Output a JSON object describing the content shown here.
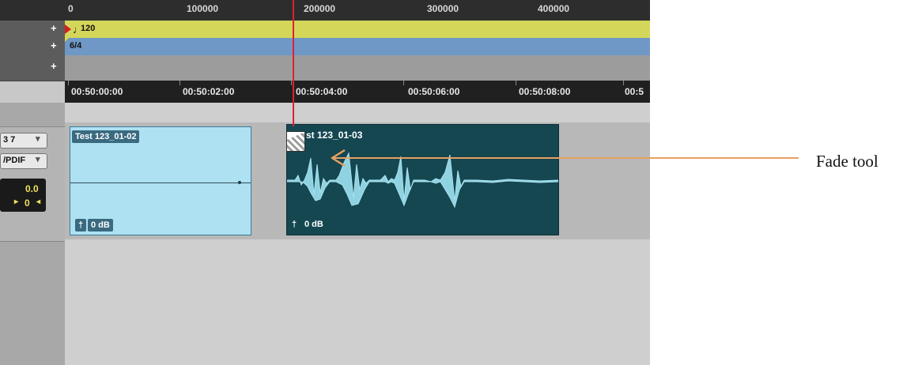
{
  "sample_ruler": {
    "ticks": [
      "0",
      "100000",
      "200000",
      "300000",
      "400000"
    ]
  },
  "tempo_lane": {
    "value": "120"
  },
  "meter_lane": {
    "value": "6/4"
  },
  "timecode_ruler": {
    "ticks": [
      "00:50:00:00",
      "00:50:02:00",
      "00:50:04:00",
      "00:50:06:00",
      "00:50:08:00",
      "00:5"
    ]
  },
  "track_header": {
    "output_label": "3 7",
    "input_label": "/PDIF",
    "volume_value": "0.0",
    "pan_value": "0"
  },
  "clips": [
    {
      "name": "Test 123_01-02",
      "gain": "0 dB"
    },
    {
      "name": "st 123_01-03",
      "gain": "0 dB"
    }
  ],
  "annotation": {
    "label": "Fade tool"
  },
  "colors": {
    "tempo_lane": "#d4d65a",
    "meter_lane": "#6f98c6",
    "playhead": "#e02030",
    "arrow": "#e8a060"
  },
  "icons": {
    "tempo_note": "quarter-note-icon",
    "fade_tool": "fade-tool-icon"
  }
}
